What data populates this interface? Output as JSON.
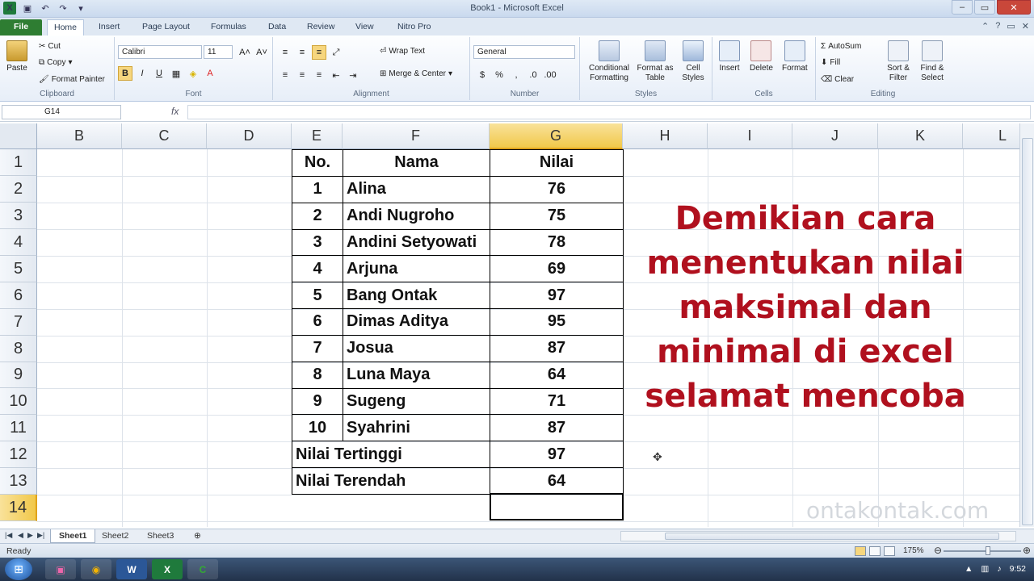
{
  "window": {
    "title": "Book1 - Microsoft Excel"
  },
  "ribbon_tabs": [
    "File",
    "Home",
    "Insert",
    "Page Layout",
    "Formulas",
    "Data",
    "Review",
    "View",
    "Nitro Pro"
  ],
  "clipboard": {
    "paste": "Paste",
    "cut": "Cut",
    "copy": "Copy",
    "format_painter": "Format Painter",
    "label": "Clipboard"
  },
  "font": {
    "name": "Calibri",
    "size": "11",
    "label": "Font",
    "bold": "B",
    "italic": "I",
    "underline": "U"
  },
  "alignment": {
    "wrap": "Wrap Text",
    "merge": "Merge & Center",
    "label": "Alignment"
  },
  "number": {
    "format": "General",
    "label": "Number",
    "percent": "%",
    "comma": ","
  },
  "styles": {
    "cond": "Conditional Formatting",
    "table": "Format as Table",
    "cell": "Cell Styles",
    "label": "Styles"
  },
  "cells": {
    "insert": "Insert",
    "delete": "Delete",
    "format": "Format",
    "label": "Cells"
  },
  "editing": {
    "autosum": "AutoSum",
    "fill": "Fill",
    "clear": "Clear",
    "sort": "Sort & Filter",
    "find": "Find & Select",
    "label": "Editing"
  },
  "formula_bar": {
    "name_box": "G14",
    "fx": "fx",
    "value": ""
  },
  "columns": [
    "B",
    "C",
    "D",
    "E",
    "F",
    "G",
    "H",
    "I",
    "J",
    "K",
    "L"
  ],
  "rows": [
    "1",
    "2",
    "3",
    "4",
    "5",
    "6",
    "7",
    "8",
    "9",
    "10",
    "11",
    "12",
    "13",
    "14"
  ],
  "table": {
    "headers": [
      "No.",
      "Nama",
      "Nilai"
    ],
    "data": [
      [
        "1",
        "Alina",
        "76"
      ],
      [
        "2",
        "Andi Nugroho",
        "75"
      ],
      [
        "3",
        "Andini Setyowati",
        "78"
      ],
      [
        "4",
        "Arjuna",
        "69"
      ],
      [
        "5",
        "Bang Ontak",
        "97"
      ],
      [
        "6",
        "Dimas Aditya",
        "95"
      ],
      [
        "7",
        "Josua",
        "87"
      ],
      [
        "8",
        "Luna Maya",
        "64"
      ],
      [
        "9",
        "Sugeng",
        "71"
      ],
      [
        "10",
        "Syahrini",
        "87"
      ]
    ],
    "max_label": "Nilai Tertinggi",
    "max_value": "97",
    "min_label": "Nilai Terendah",
    "min_value": "64"
  },
  "overlay_text": [
    "Demikian cara",
    "menentukan nilai",
    "maksimal dan",
    "minimal di excel",
    "selamat mencoba"
  ],
  "watermark": "ontakontak.com",
  "sheets": [
    "Sheet1",
    "Sheet2",
    "Sheet3"
  ],
  "status": {
    "ready": "Ready",
    "zoom": "175%"
  },
  "clock": "9:52",
  "colors": {
    "overlay": "#b0101e",
    "result": "#e01b1b",
    "file_tab": "#2e7d32",
    "selection": "#f1c84a"
  }
}
